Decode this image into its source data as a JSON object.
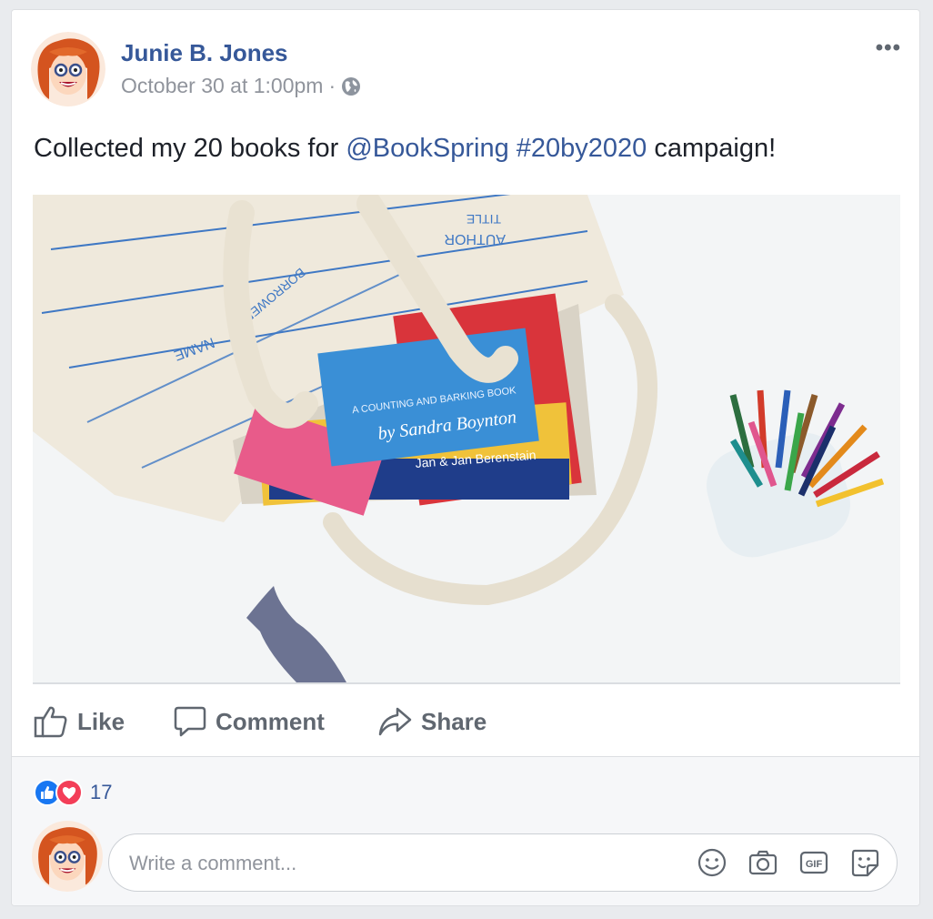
{
  "post": {
    "author": "Junie B. Jones",
    "timestamp": "October 30 at 1:00pm",
    "separator": "·",
    "privacy_icon": "globe-icon",
    "more_label": "•••",
    "text_prefix": "Collected my 20 books for ",
    "mention": "@BookSpring",
    "hashtag": "#20by2020",
    "text_suffix": " campaign!"
  },
  "photo": {
    "book_subtitle": "A COUNTING AND BARKING BOOK",
    "book_author": "by Sandra Boynton",
    "book_author2": "Jan & Jan Berenstain",
    "bag_text1": "AUTHOR",
    "bag_text2": "TITLE",
    "bag_text3": "NAME",
    "bag_text4": "BORROWER"
  },
  "actions": {
    "like": "Like",
    "comment": "Comment",
    "share": "Share"
  },
  "reactions": {
    "count": "17",
    "types": [
      "like-icon",
      "love-icon"
    ]
  },
  "composer": {
    "placeholder": "Write a comment...",
    "icons": [
      "emoji-icon",
      "camera-icon",
      "gif-icon",
      "sticker-icon"
    ]
  },
  "colors": {
    "link": "#365899",
    "muted": "#90949c",
    "like_blue": "#1877f2",
    "love_red": "#f33e58"
  }
}
